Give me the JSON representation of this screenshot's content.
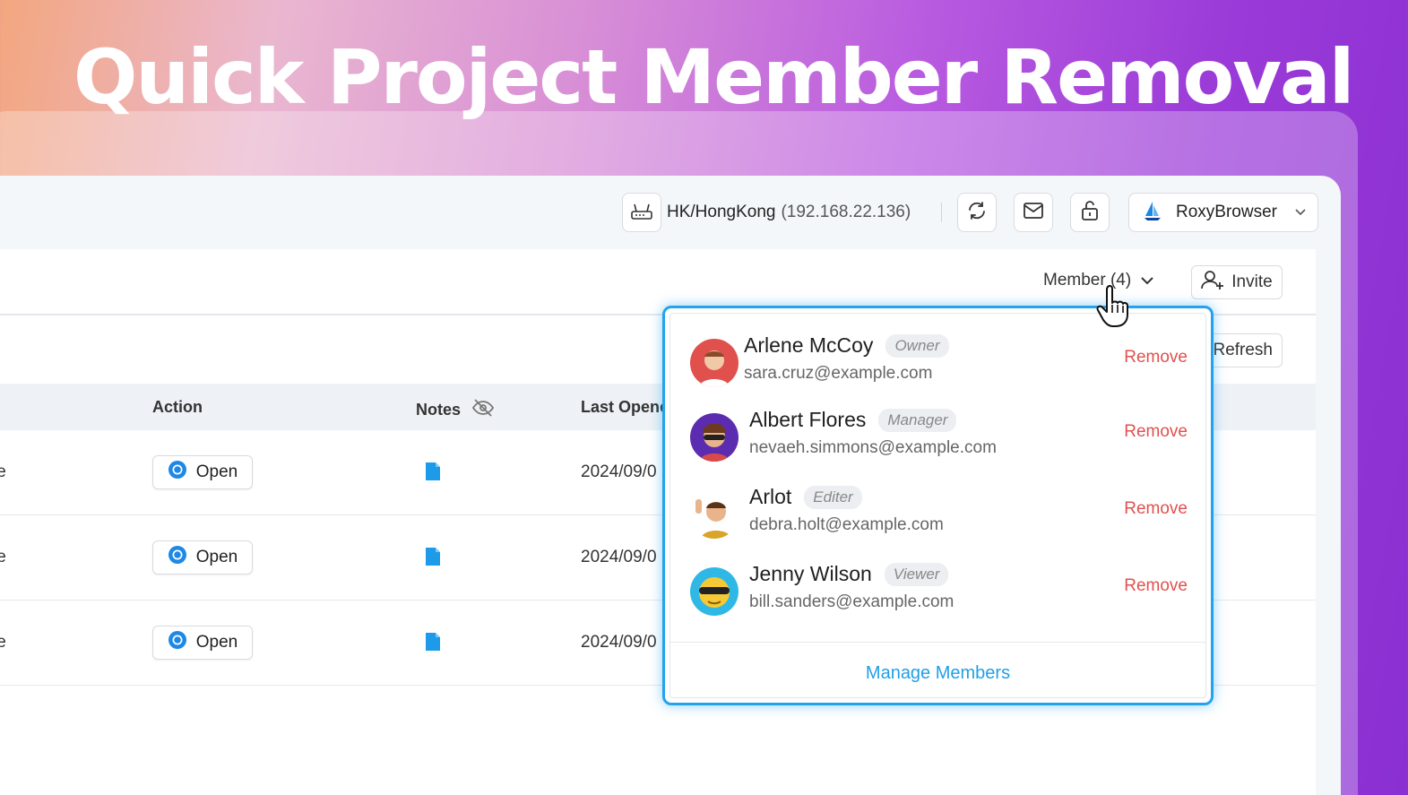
{
  "hero": {
    "title": "Quick Project Member Removal"
  },
  "topbar": {
    "proxy_location": "HK/HongKong",
    "proxy_ip": "(192.168.22.136)",
    "browser_name": "RoxyBrowser",
    "icons": [
      "router-icon",
      "refresh-icon",
      "mail-icon",
      "unlock-icon",
      "roxy-logo-icon"
    ]
  },
  "toolbar": {
    "member_label": "Member (4)",
    "invite_label": "Invite",
    "refresh_label": "Refresh"
  },
  "table": {
    "headers": {
      "action": "Action",
      "notes": "Notes",
      "last_opened": "Last Opene"
    },
    "rows": [
      {
        "name": "le",
        "action_label": "Open",
        "date": "2024/09/0"
      },
      {
        "name": "le",
        "action_label": "Open",
        "date": "2024/09/0"
      },
      {
        "name": "le",
        "action_label": "Open",
        "date": "2024/09/0"
      }
    ]
  },
  "dropdown": {
    "members": [
      {
        "name": "Arlene McCoy",
        "role": "Owner",
        "email": "sara.cruz@example.com",
        "action": "Remove"
      },
      {
        "name": "Albert Flores",
        "role": "Manager",
        "email": "nevaeh.simmons@example.com",
        "action": "Remove"
      },
      {
        "name": "Arlot",
        "role": "Editer",
        "email": "debra.holt@example.com",
        "action": "Remove"
      },
      {
        "name": "Jenny Wilson",
        "role": "Viewer",
        "email": "bill.sanders@example.com",
        "action": "Remove"
      }
    ],
    "manage_label": "Manage Members"
  },
  "colors": {
    "accent": "#23a3ee",
    "danger": "#e0514f",
    "link": "#1f9fe8"
  }
}
